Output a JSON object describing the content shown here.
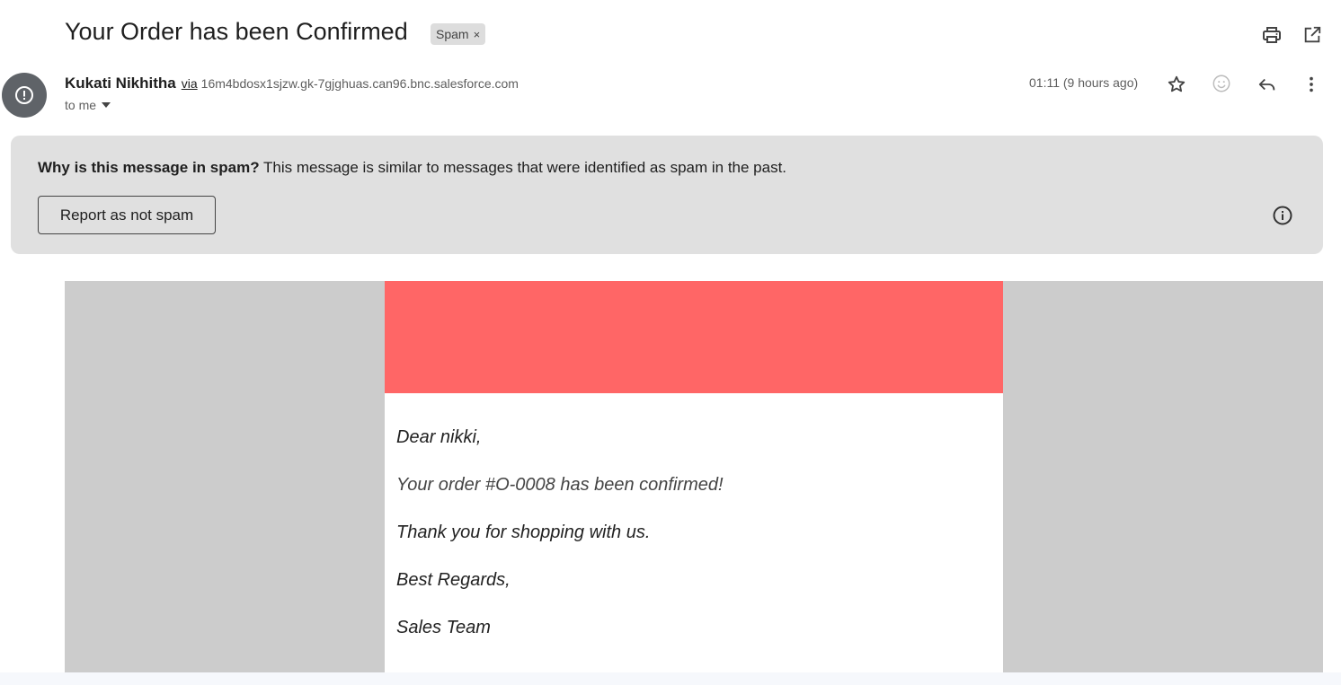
{
  "email": {
    "subject": "Your Order has been Confirmed",
    "label_chip": "Spam",
    "label_remove": "×",
    "sender_name": "Kukati Nikhitha",
    "via_label": "via",
    "sender_address": "16m4bdosx1sjzw.gk-7gjghuas.can96.bnc.salesforce.com",
    "recipient_text": "to me",
    "timestamp": "01:11 (9 hours ago)"
  },
  "toolbar": {
    "icons": [
      "print-icon",
      "open-in-new-window-icon",
      "star-icon",
      "emoji-reaction-icon",
      "reply-icon",
      "more-options-icon"
    ]
  },
  "spam_banner": {
    "question": "Why is this message in spam?",
    "explanation": " This message is similar to messages that were identified as spam in the past.",
    "button_label": "Report as not spam"
  },
  "message_body": {
    "greeting": "Dear nikki,",
    "order_line": "Your order #O-0008 has been confirmed!",
    "thanks_line": "Thank you for shopping with us.",
    "closing": "Best Regards,",
    "signature": "Sales Team"
  },
  "colors": {
    "email_header": "#ff6666",
    "email_outer_bg": "#cccccc",
    "banner_bg": "#e0e0e0",
    "avatar_bg": "#5f6368"
  }
}
